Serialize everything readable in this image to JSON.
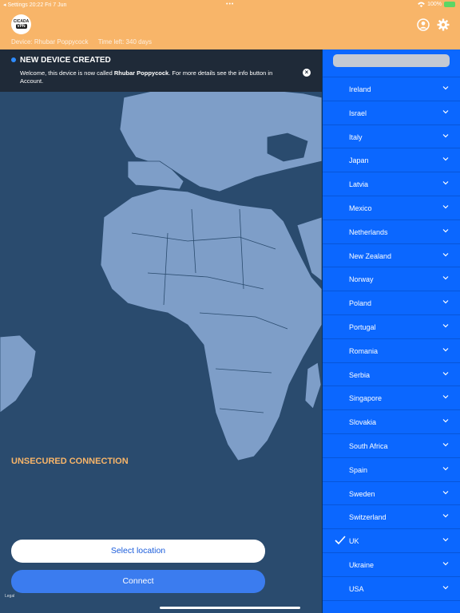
{
  "status_bar": {
    "left": "◂ Settings  20:22  Fri 7 Jun",
    "dots": "•••",
    "battery_text": "100%"
  },
  "header": {
    "logo_line1": "CICADA",
    "logo_line2": "VPN",
    "device_label": "Device: Rhubar Poppycock",
    "time_left": "Time left: 340 days",
    "account_icon": "account-icon",
    "settings_icon": "gear-icon"
  },
  "banner": {
    "title": "NEW DEVICE CREATED",
    "body_prefix": "Welcome, this device is now called ",
    "device_name": "Rhubar Poppycock",
    "body_suffix": ". For more details see the info button in Account."
  },
  "connection_status": "UNSECURED CONNECTION",
  "buttons": {
    "select_location": "Select location",
    "connect": "Connect"
  },
  "legal": "Legal",
  "locations": [
    "Ireland",
    "Israel",
    "Italy",
    "Japan",
    "Latvia",
    "Mexico",
    "Netherlands",
    "New Zealand",
    "Norway",
    "Poland",
    "Portugal",
    "Romania",
    "Serbia",
    "Singapore",
    "Slovakia",
    "South Africa",
    "Spain",
    "Sweden",
    "Switzerland",
    "UK",
    "Ukraine",
    "USA"
  ],
  "selected_location": "UK",
  "colors": {
    "header": "#f8b569",
    "panel": "#0b67ff",
    "map_sea": "#2a4b6e",
    "map_land": "#7e9ec8",
    "connect": "#3b7cef"
  }
}
